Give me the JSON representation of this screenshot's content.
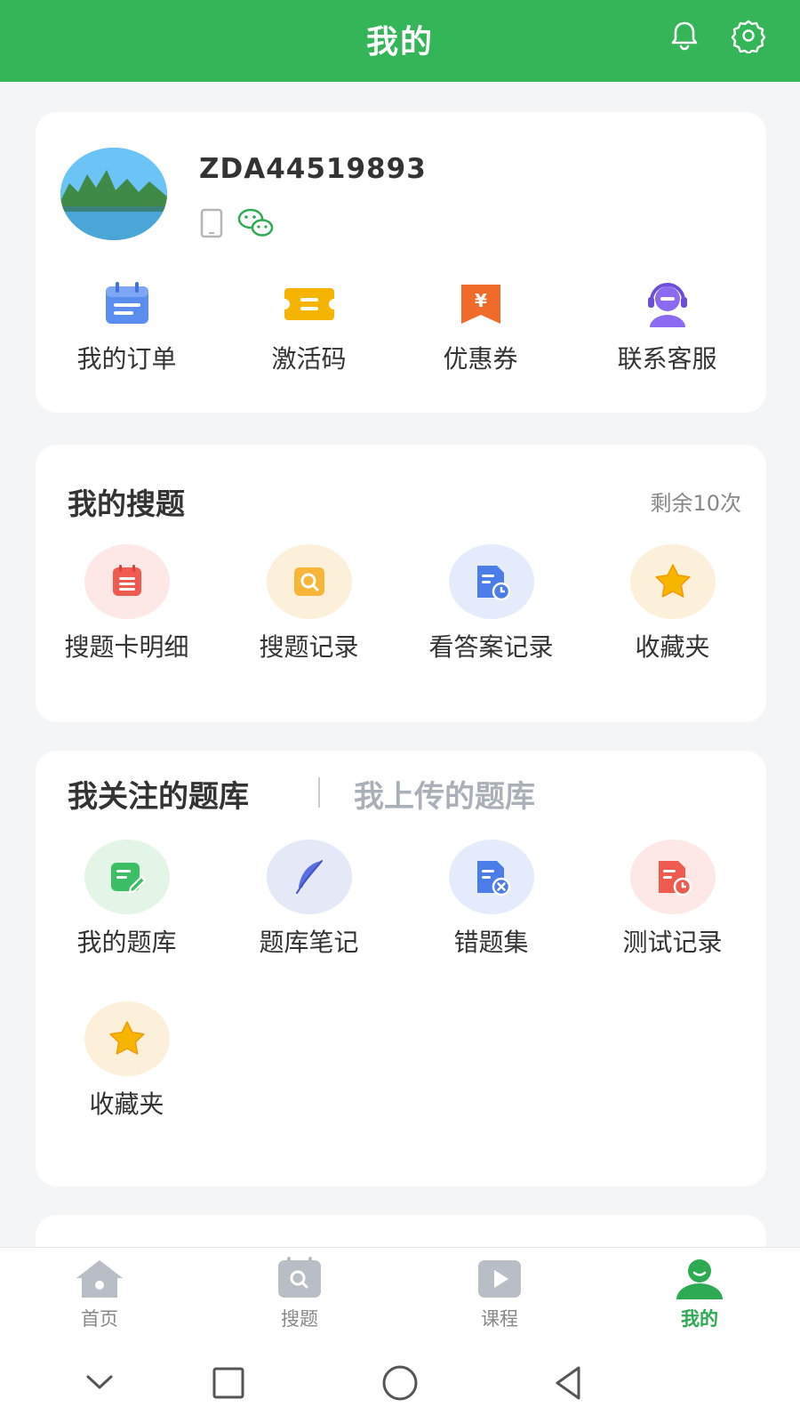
{
  "header": {
    "title": "我的",
    "bell_icon": "bell-icon",
    "settings_icon": "gear-icon"
  },
  "profile": {
    "username": "ZDA44519893",
    "avatar": "landscape-avatar",
    "badges": [
      "phone-icon",
      "wechat-icon"
    ],
    "quick_actions": [
      {
        "label": "我的订单",
        "icon": "calendar-icon",
        "color": "#5b8def"
      },
      {
        "label": "激活码",
        "icon": "ticket-icon",
        "color": "#f5b400"
      },
      {
        "label": "优惠券",
        "icon": "coupon-icon",
        "color": "#f06a2a"
      },
      {
        "label": "联系客服",
        "icon": "headset-icon",
        "color": "#8b6cf0"
      }
    ]
  },
  "search": {
    "title": "我的搜题",
    "remaining": "剩余10次",
    "items": [
      {
        "label": "搜题卡明细",
        "icon": "card-list-icon",
        "bg": "#fde8e6",
        "color": "#ef5b4f"
      },
      {
        "label": "搜题记录",
        "icon": "search-record-icon",
        "bg": "#fdf0da",
        "color": "#f7b53a"
      },
      {
        "label": "看答案记录",
        "icon": "answer-record-icon",
        "bg": "#e4ecfb",
        "color": "#4a7de8"
      },
      {
        "label": "收藏夹",
        "icon": "star-icon",
        "bg": "#fdf0da",
        "color": "#f7b500"
      }
    ]
  },
  "bank": {
    "tab_active": "我关注的题库",
    "tab_inactive": "我上传的题库",
    "items": [
      {
        "label": "我的题库",
        "icon": "edit-doc-icon",
        "bg": "#e2f5e6",
        "color": "#3cbf64"
      },
      {
        "label": "题库笔记",
        "icon": "feather-icon",
        "bg": "#e4e8f7",
        "color": "#5a6fe0"
      },
      {
        "label": "错题集",
        "icon": "error-doc-icon",
        "bg": "#e4ecfb",
        "color": "#4a7de8"
      },
      {
        "label": "测试记录",
        "icon": "test-record-icon",
        "bg": "#fde8e6",
        "color": "#ef5b4f"
      },
      {
        "label": "收藏夹",
        "icon": "star-icon",
        "bg": "#fdf0da",
        "color": "#f7b500"
      }
    ]
  },
  "bottom_nav": {
    "items": [
      {
        "label": "首页",
        "icon": "home-icon",
        "active": false
      },
      {
        "label": "搜题",
        "icon": "search-tab-icon",
        "active": false
      },
      {
        "label": "课程",
        "icon": "play-icon",
        "active": false
      },
      {
        "label": "我的",
        "icon": "user-icon",
        "active": true
      }
    ]
  },
  "system_bar": [
    "chevron-down-icon",
    "square-icon",
    "circle-icon",
    "back-triangle-icon"
  ],
  "colors": {
    "brand": "#34b558",
    "active_tab": "#2eaa52",
    "background": "#f4f5f7"
  }
}
